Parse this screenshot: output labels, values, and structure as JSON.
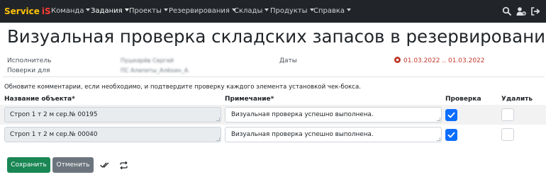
{
  "navbar": {
    "brand": "Service",
    "brand_suffix": "iS",
    "items": [
      {
        "label": "Команда",
        "active": false
      },
      {
        "label": "Задания",
        "active": true
      },
      {
        "label": "Проекты",
        "active": false
      },
      {
        "label": "Резервирования",
        "active": false
      },
      {
        "label": "Склады",
        "active": false
      },
      {
        "label": "Продукты",
        "active": false
      },
      {
        "label": "Справка",
        "active": false
      }
    ],
    "icons": [
      "search-icon",
      "user-settings-icon",
      "logout-icon"
    ]
  },
  "page_title": "Визуальная проверка складских запасов в резервировании",
  "info": {
    "executor_label": "Исполнитель",
    "executor_value": "Пушкарёв Сергей",
    "checks_for_label": "Поверки для",
    "checks_for_value": "ПС Алапиты_Алёхин_А.",
    "dates_label": "Даты",
    "date_range": "01.03.2022 .. 01.03.2022"
  },
  "instructions": "Обновите комментарии, если необходимо, и подтвердите проверку каждого элемента установкой чек-бокса.",
  "table": {
    "headers": {
      "object": "Название объекта*",
      "note": "Примечание*",
      "check": "Проверка",
      "delete": "Удалить"
    },
    "rows": [
      {
        "object": "Строп 1 т 2 м сер.№ 00195",
        "note": "Визуальная проверка успешно выполнена.",
        "checked": true,
        "delete": false
      },
      {
        "object": "Строп 1 т 2 м сер.№ 00040",
        "note": "Визуальная проверка успешно выполнена.",
        "checked": true,
        "delete": false
      }
    ]
  },
  "buttons": {
    "save": "Сохранить",
    "cancel": "Отменить",
    "icons": [
      "check-all-icon",
      "refresh-icon"
    ]
  },
  "colors": {
    "navbar_bg": "#212529",
    "brand": "#ffc107",
    "brand_suffix": "#ff3b30",
    "date_range": "#c0392b",
    "checkbox": "#0d6efd",
    "save_button": "#198754",
    "cancel_button": "#6c757d"
  }
}
